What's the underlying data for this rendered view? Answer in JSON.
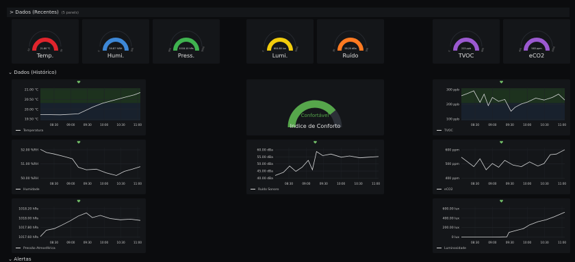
{
  "rows": {
    "recent_title": "> Dados (Recentes)",
    "recent_count": "(5 panels)",
    "history_title": "⌄ Dados (Histórico)",
    "alerts_title": "⌄ Alertas"
  },
  "gauges": [
    {
      "label": "Temp.",
      "value": "21.80 °C",
      "min": "-10",
      "max": "50",
      "color": "#e0242c",
      "fraction": 0.53
    },
    {
      "label": "Humi.",
      "value": "50.87 %RH",
      "min": "0",
      "max": "100",
      "color": "#3d87d6",
      "fraction": 0.51
    },
    {
      "label": "Press.",
      "value": "1018.10 hPa",
      "min": "950",
      "max": "1050",
      "color": "#3fb34f",
      "fraction": 0.68
    },
    {
      "label": "Lumi.",
      "value": "604.80 lux",
      "min": "0",
      "max": "1000",
      "color": "#f2cc0c",
      "fraction": 0.6
    },
    {
      "label": "Ruído",
      "value": "58.20 dBa",
      "min": "30",
      "max": "100",
      "color": "#ff7a21",
      "fraction": 0.4
    },
    {
      "label": "TVOC",
      "value": "223 ppb",
      "min": "0",
      "max": "600",
      "color": "#9b59d0",
      "fraction": 0.37
    },
    {
      "label": "eCO2",
      "value": "583 ppm",
      "min": "400",
      "max": "2000",
      "color": "#9b59d0",
      "fraction": 0.12
    }
  ],
  "comfort": {
    "status": "Confortável",
    "title": "Indice de Conforto",
    "color": "#56a64b",
    "fraction": 0.78
  },
  "time_axis": [
    "08:30",
    "09:00",
    "09:30",
    "10:00",
    "10:30",
    "11:00"
  ],
  "charts": [
    {
      "legend": "Temperatura",
      "yticks": [
        "21.00 °C",
        "20.50 °C",
        "20.00 °C",
        "19.50 °C"
      ],
      "threshold_band": true
    },
    {
      "legend": "Humidade",
      "yticks": [
        "52.00 %RH",
        "51.00 %RH",
        "50.00 %RH"
      ],
      "threshold_band": false
    },
    {
      "legend": "Pressão Atmosférica",
      "yticks": [
        "1018.20 hPa",
        "1018.00 hPa",
        "1017.80 hPa",
        "1017.60 hPa"
      ],
      "threshold_band": false
    },
    {
      "legend": "Ruído Sonoro",
      "yticks": [
        "60.00 dBa",
        "55.00 dBa",
        "50.00 dBa",
        "45.00 dBa",
        "40.00 dBa"
      ],
      "threshold_band": false
    },
    {
      "legend": "TVOC",
      "yticks": [
        "300 ppb",
        "200 ppb",
        "100 ppb"
      ],
      "threshold_band": true
    },
    {
      "legend": "eCO2",
      "yticks": [
        "600 ppm",
        "500 ppm",
        "400 ppm"
      ],
      "threshold_band": false
    },
    {
      "legend": "Luminosidade",
      "yticks": [
        "600.00 lux",
        "400.00 lux",
        "200.00 lux",
        "0 lux"
      ],
      "threshold_band": false
    }
  ]
}
